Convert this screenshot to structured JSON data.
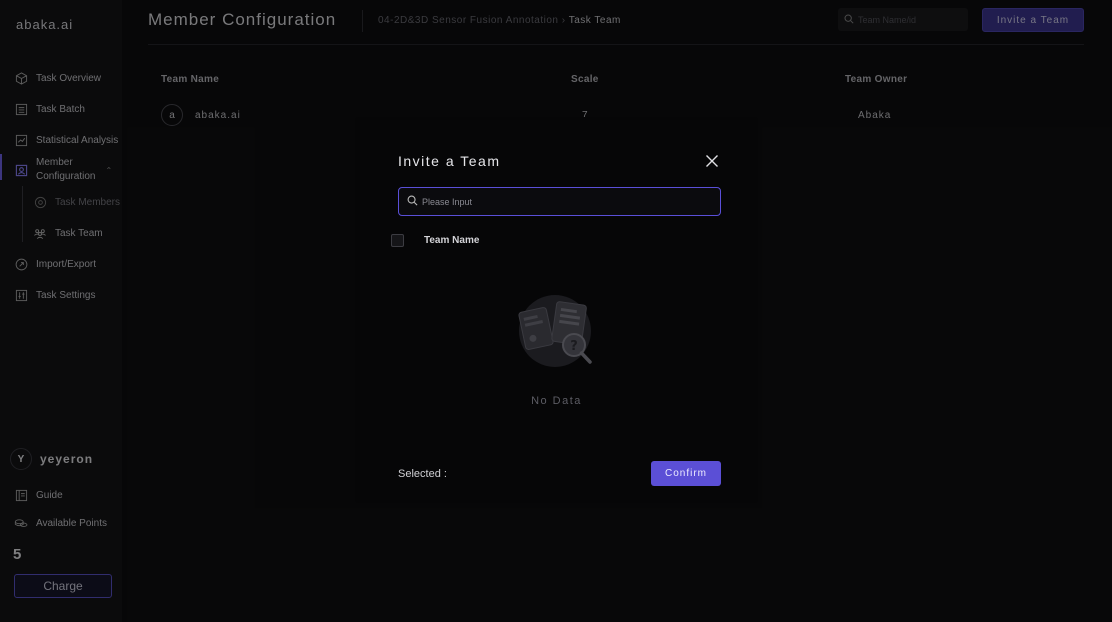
{
  "app": {
    "logo": "abaka.ai"
  },
  "sidebar": {
    "items": [
      {
        "label": "Task Overview",
        "icon": "cube-icon"
      },
      {
        "label": "Task Batch",
        "icon": "list-icon"
      },
      {
        "label": "Statistical Analysis",
        "icon": "chart-icon"
      },
      {
        "label_line1": "Member",
        "label_line2": "Configuration",
        "icon": "member-icon"
      },
      {
        "label": "Task Members",
        "icon": "at-icon"
      },
      {
        "label": "Task Team",
        "icon": "team-icon"
      },
      {
        "label": "Import/Export",
        "icon": "import-export-icon"
      },
      {
        "label": "Task Settings",
        "icon": "settings-sliders-icon"
      }
    ],
    "user": {
      "initial": "Y",
      "name": "yeyeron"
    },
    "guide_label": "Guide",
    "points_label": "Available Points",
    "points_value": "5",
    "charge_label": "Charge"
  },
  "header": {
    "title": "Member Configuration",
    "breadcrumb_parent": "04-2D&3D Sensor Fusion Annotation",
    "breadcrumb_sep": " › ",
    "breadcrumb_current": "Task Team",
    "search_placeholder": "Team Name/id",
    "invite_label": "Invite a Team"
  },
  "table": {
    "columns": [
      "Team Name",
      "Scale",
      "Team Owner"
    ],
    "rows": [
      {
        "avatar": "a",
        "team_name": "abaka.ai",
        "scale": "7",
        "owner": "Abaka"
      }
    ]
  },
  "modal": {
    "title": "Invite a Team",
    "search_placeholder": "Please Input",
    "column_team_name": "Team Name",
    "empty_text": "No Data",
    "selected_label": "Selected :",
    "confirm_label": "Confirm"
  },
  "colors": {
    "accent": "#5b4fd6",
    "background": "#0e0e10",
    "sidebar": "#141416"
  }
}
